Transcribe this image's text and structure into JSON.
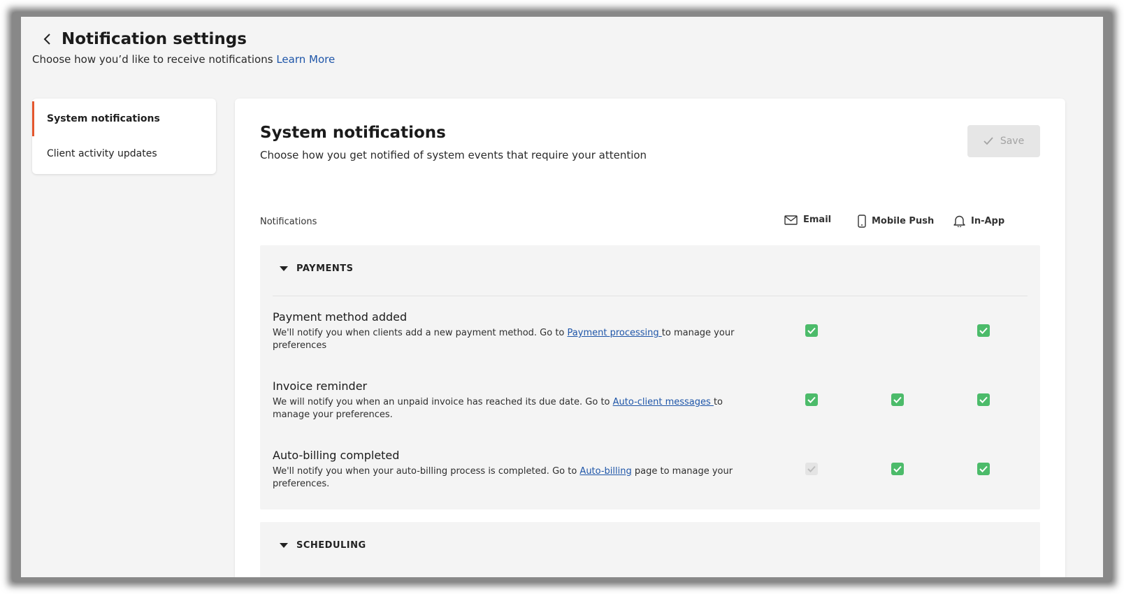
{
  "page": {
    "title": "Notification settings",
    "subtitle": "Choose how you’d like to receive notifications",
    "learn_more": "Learn More"
  },
  "sidebar": {
    "items": [
      {
        "label": "System notifications",
        "active": true
      },
      {
        "label": "Client activity updates",
        "active": false
      }
    ]
  },
  "main": {
    "title": "System notifications",
    "description": "Choose how you get notified of system events that require your attention",
    "save_label": "Save",
    "columns_label": "Notifications",
    "channels": [
      {
        "label": "Email",
        "icon": "mail-icon"
      },
      {
        "label": "Mobile Push",
        "icon": "phone-icon"
      },
      {
        "label": "In-App",
        "icon": "bell-icon"
      }
    ]
  },
  "groups": [
    {
      "label": "PAYMENTS",
      "rows": [
        {
          "title": "Payment method added",
          "desc_before": "We'll notify you when clients add a new payment method. Go to ",
          "link": "Payment processing ",
          "desc_after": "to manage your preferences",
          "email": "checked",
          "push": "none",
          "inapp": "checked"
        },
        {
          "title": "Invoice reminder",
          "desc_before": "We will notify you when an unpaid invoice has reached its due date. Go to ",
          "link": "Auto-client messages ",
          "desc_after": "to manage your preferences.",
          "email": "checked",
          "push": "checked",
          "inapp": "checked"
        },
        {
          "title": "Auto-billing completed",
          "desc_before": "We'll notify you when your auto-billing process is completed. Go to ",
          "link": "Auto-billing",
          "desc_after": " page to manage your preferences.",
          "email": "disabled",
          "push": "checked",
          "inapp": "checked"
        }
      ]
    },
    {
      "label": "SCHEDULING",
      "rows": []
    }
  ],
  "colors": {
    "accent": "#e4572e",
    "link": "#1e55a8",
    "checkbox": "#4cbb6a"
  }
}
